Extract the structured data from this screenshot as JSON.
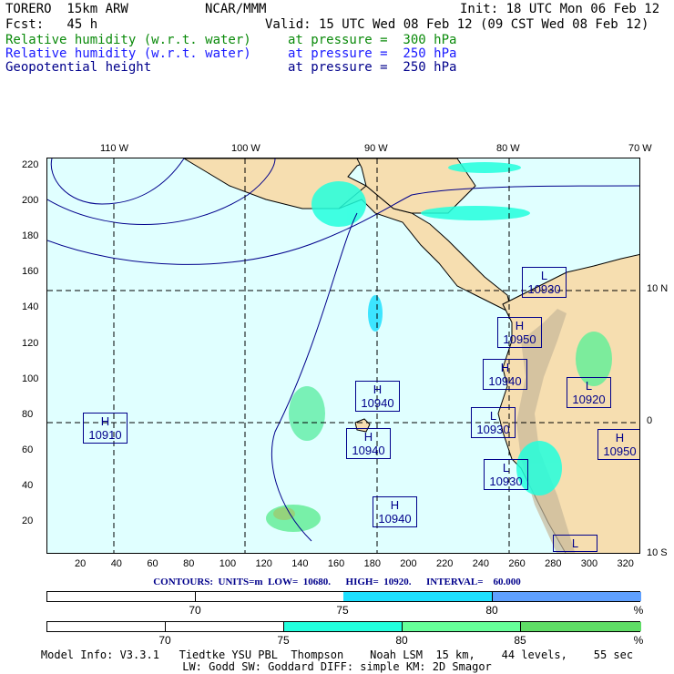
{
  "header": {
    "model": "TORERO  15km ARW",
    "org": "NCAR/MMM",
    "init": "Init: 18 UTC Mon 06 Feb 12",
    "fcst": "Fcst:   45 h",
    "valid": "Valid: 15 UTC Wed 08 Feb 12 (09 CST Wed 08 Feb 12)",
    "fields": [
      {
        "name": "Relative humidity (w.r.t. water)",
        "level": "at pressure =  300 hPa",
        "color": "#0a8a0a"
      },
      {
        "name": "Relative humidity (w.r.t. water)",
        "level": "at pressure =  250 hPa",
        "color": "#1a1aff"
      },
      {
        "name": "Geopotential height",
        "level": "at pressure =  250 hPa",
        "color": "#00008b"
      }
    ]
  },
  "map": {
    "x_ticks": [
      "20",
      "40",
      "60",
      "80",
      "100",
      "120",
      "140",
      "160",
      "180",
      "200",
      "220",
      "240",
      "260",
      "280",
      "300",
      "320"
    ],
    "y_ticks": [
      "220",
      "200",
      "180",
      "160",
      "140",
      "120",
      "100",
      "80",
      "60",
      "40",
      "20"
    ],
    "lon_labels": [
      "110 W",
      "100 W",
      "90 W",
      "80 W",
      "70 W"
    ],
    "lat_labels": [
      "10 N",
      "0",
      "10 S"
    ],
    "systems": [
      {
        "type": "L",
        "value": "10930"
      },
      {
        "type": "H",
        "value": "10950"
      },
      {
        "type": "H",
        "value": "10940"
      },
      {
        "type": "L",
        "value": "10920"
      },
      {
        "type": "H",
        "value": "10940"
      },
      {
        "type": "L",
        "value": "10930"
      },
      {
        "type": "H",
        "value": "10910"
      },
      {
        "type": "H",
        "value": "10940"
      },
      {
        "type": "H",
        "value": "10950"
      },
      {
        "type": "L",
        "value": "10930"
      },
      {
        "type": "H",
        "value": "10940"
      },
      {
        "type": "L",
        "value": ""
      }
    ]
  },
  "contours": "CONTOURS:  UNITS=m  LOW=  10680.      HIGH=  10920.      INTERVAL=    60.000",
  "colorbar1": {
    "labels": [
      "70",
      "75",
      "80",
      "%"
    ],
    "colors": [
      "#ffffff",
      "#ffffff",
      "#1ee0ff",
      "#5fa0ff"
    ]
  },
  "colorbar2": {
    "labels": [
      "70",
      "75",
      "80",
      "85",
      "%"
    ],
    "colors": [
      "#ffffff",
      "#ffffff",
      "#22ffdd",
      "#66ff99",
      "#5fdd66"
    ]
  },
  "model_info": {
    "line1": "Model Info: V3.3.1   Tiedtke YSU PBL  Thompson    Noah LSM  15 km,    44 levels,    55 sec",
    "line2": "LW: Godd SW: Goddard DIFF: simple KM: 2D Smagor"
  }
}
